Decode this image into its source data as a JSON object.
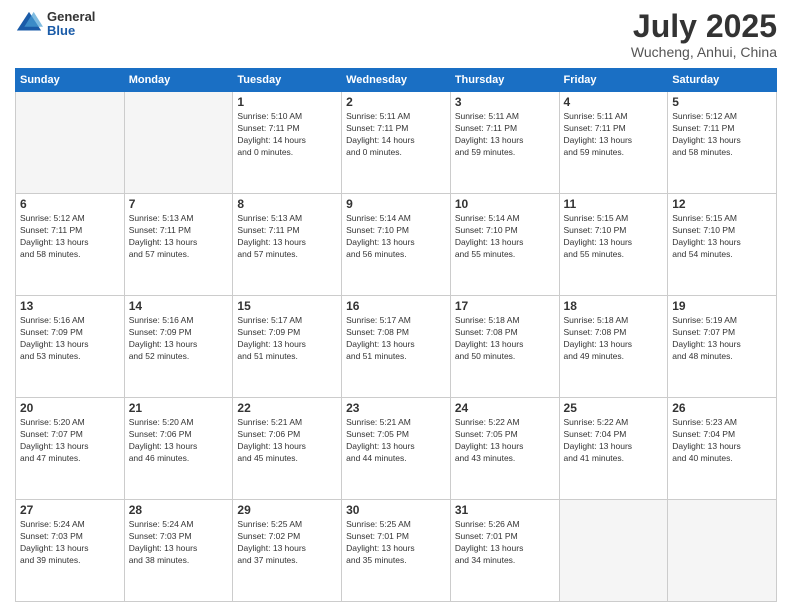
{
  "header": {
    "logo": {
      "line1": "General",
      "line2": "Blue"
    },
    "title": "July 2025",
    "location": "Wucheng, Anhui, China"
  },
  "weekdays": [
    "Sunday",
    "Monday",
    "Tuesday",
    "Wednesday",
    "Thursday",
    "Friday",
    "Saturday"
  ],
  "weeks": [
    [
      {
        "day": "",
        "info": ""
      },
      {
        "day": "",
        "info": ""
      },
      {
        "day": "1",
        "info": "Sunrise: 5:10 AM\nSunset: 7:11 PM\nDaylight: 14 hours\nand 0 minutes."
      },
      {
        "day": "2",
        "info": "Sunrise: 5:11 AM\nSunset: 7:11 PM\nDaylight: 14 hours\nand 0 minutes."
      },
      {
        "day": "3",
        "info": "Sunrise: 5:11 AM\nSunset: 7:11 PM\nDaylight: 13 hours\nand 59 minutes."
      },
      {
        "day": "4",
        "info": "Sunrise: 5:11 AM\nSunset: 7:11 PM\nDaylight: 13 hours\nand 59 minutes."
      },
      {
        "day": "5",
        "info": "Sunrise: 5:12 AM\nSunset: 7:11 PM\nDaylight: 13 hours\nand 58 minutes."
      }
    ],
    [
      {
        "day": "6",
        "info": "Sunrise: 5:12 AM\nSunset: 7:11 PM\nDaylight: 13 hours\nand 58 minutes."
      },
      {
        "day": "7",
        "info": "Sunrise: 5:13 AM\nSunset: 7:11 PM\nDaylight: 13 hours\nand 57 minutes."
      },
      {
        "day": "8",
        "info": "Sunrise: 5:13 AM\nSunset: 7:11 PM\nDaylight: 13 hours\nand 57 minutes."
      },
      {
        "day": "9",
        "info": "Sunrise: 5:14 AM\nSunset: 7:10 PM\nDaylight: 13 hours\nand 56 minutes."
      },
      {
        "day": "10",
        "info": "Sunrise: 5:14 AM\nSunset: 7:10 PM\nDaylight: 13 hours\nand 55 minutes."
      },
      {
        "day": "11",
        "info": "Sunrise: 5:15 AM\nSunset: 7:10 PM\nDaylight: 13 hours\nand 55 minutes."
      },
      {
        "day": "12",
        "info": "Sunrise: 5:15 AM\nSunset: 7:10 PM\nDaylight: 13 hours\nand 54 minutes."
      }
    ],
    [
      {
        "day": "13",
        "info": "Sunrise: 5:16 AM\nSunset: 7:09 PM\nDaylight: 13 hours\nand 53 minutes."
      },
      {
        "day": "14",
        "info": "Sunrise: 5:16 AM\nSunset: 7:09 PM\nDaylight: 13 hours\nand 52 minutes."
      },
      {
        "day": "15",
        "info": "Sunrise: 5:17 AM\nSunset: 7:09 PM\nDaylight: 13 hours\nand 51 minutes."
      },
      {
        "day": "16",
        "info": "Sunrise: 5:17 AM\nSunset: 7:08 PM\nDaylight: 13 hours\nand 51 minutes."
      },
      {
        "day": "17",
        "info": "Sunrise: 5:18 AM\nSunset: 7:08 PM\nDaylight: 13 hours\nand 50 minutes."
      },
      {
        "day": "18",
        "info": "Sunrise: 5:18 AM\nSunset: 7:08 PM\nDaylight: 13 hours\nand 49 minutes."
      },
      {
        "day": "19",
        "info": "Sunrise: 5:19 AM\nSunset: 7:07 PM\nDaylight: 13 hours\nand 48 minutes."
      }
    ],
    [
      {
        "day": "20",
        "info": "Sunrise: 5:20 AM\nSunset: 7:07 PM\nDaylight: 13 hours\nand 47 minutes."
      },
      {
        "day": "21",
        "info": "Sunrise: 5:20 AM\nSunset: 7:06 PM\nDaylight: 13 hours\nand 46 minutes."
      },
      {
        "day": "22",
        "info": "Sunrise: 5:21 AM\nSunset: 7:06 PM\nDaylight: 13 hours\nand 45 minutes."
      },
      {
        "day": "23",
        "info": "Sunrise: 5:21 AM\nSunset: 7:05 PM\nDaylight: 13 hours\nand 44 minutes."
      },
      {
        "day": "24",
        "info": "Sunrise: 5:22 AM\nSunset: 7:05 PM\nDaylight: 13 hours\nand 43 minutes."
      },
      {
        "day": "25",
        "info": "Sunrise: 5:22 AM\nSunset: 7:04 PM\nDaylight: 13 hours\nand 41 minutes."
      },
      {
        "day": "26",
        "info": "Sunrise: 5:23 AM\nSunset: 7:04 PM\nDaylight: 13 hours\nand 40 minutes."
      }
    ],
    [
      {
        "day": "27",
        "info": "Sunrise: 5:24 AM\nSunset: 7:03 PM\nDaylight: 13 hours\nand 39 minutes."
      },
      {
        "day": "28",
        "info": "Sunrise: 5:24 AM\nSunset: 7:03 PM\nDaylight: 13 hours\nand 38 minutes."
      },
      {
        "day": "29",
        "info": "Sunrise: 5:25 AM\nSunset: 7:02 PM\nDaylight: 13 hours\nand 37 minutes."
      },
      {
        "day": "30",
        "info": "Sunrise: 5:25 AM\nSunset: 7:01 PM\nDaylight: 13 hours\nand 35 minutes."
      },
      {
        "day": "31",
        "info": "Sunrise: 5:26 AM\nSunset: 7:01 PM\nDaylight: 13 hours\nand 34 minutes."
      },
      {
        "day": "",
        "info": ""
      },
      {
        "day": "",
        "info": ""
      }
    ]
  ]
}
